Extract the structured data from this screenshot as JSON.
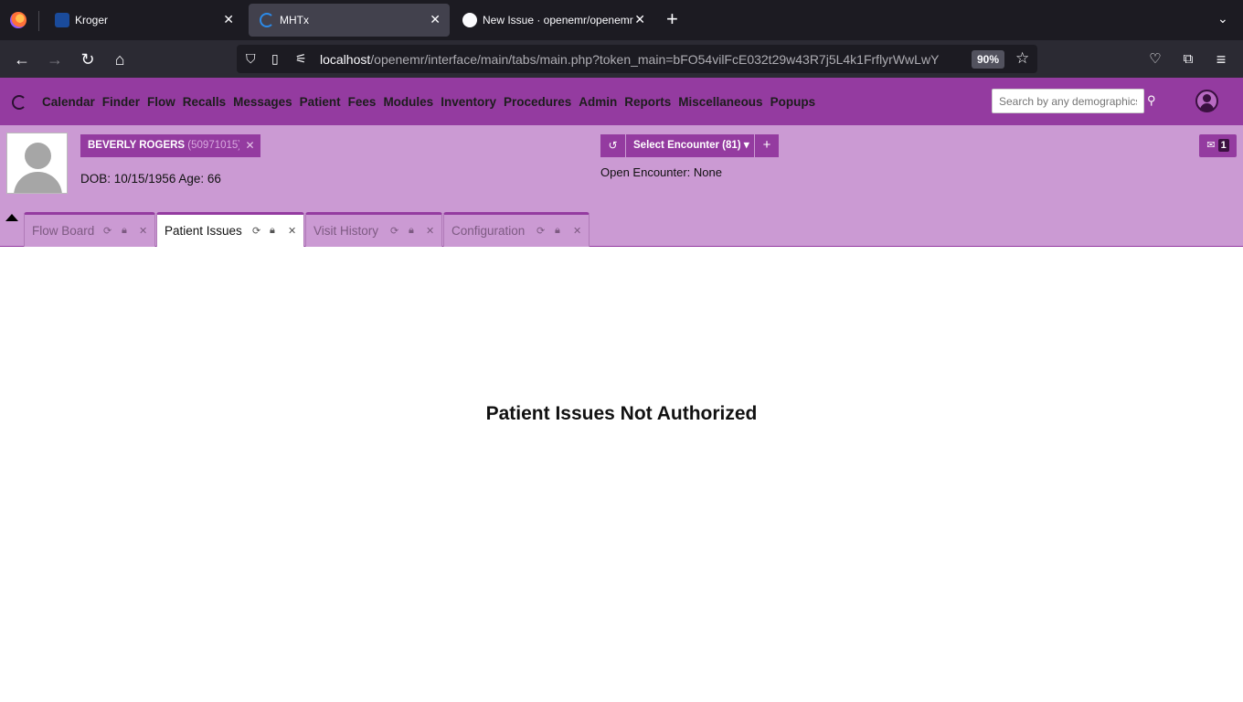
{
  "browser": {
    "tabs": [
      {
        "title": "Kroger",
        "active": false
      },
      {
        "title": "MHTx",
        "active": true
      },
      {
        "title": "New Issue · openemr/openemr",
        "active": false
      }
    ],
    "url_host": "localhost",
    "url_path": "/openemr/interface/main/tabs/main.php?token_main=bFO54vilFcE032t29w43R7j5L4k1FrflyrWwLwY",
    "zoom": "90%"
  },
  "menu": [
    "Calendar",
    "Finder",
    "Flow",
    "Recalls",
    "Messages",
    "Patient",
    "Fees",
    "Modules",
    "Inventory",
    "Procedures",
    "Admin",
    "Reports",
    "Miscellaneous",
    "Popups"
  ],
  "search": {
    "placeholder": "Search by any demographics"
  },
  "patient": {
    "name": "BEVERLY ROGERS",
    "pid": "(50971015)",
    "dob_label": "DOB: 10/15/1956 Age: 66"
  },
  "encounter": {
    "select_label": "Select Encounter",
    "count": "(81)",
    "open_label": "Open Encounter: None"
  },
  "messages": {
    "count": "1"
  },
  "tabs": [
    {
      "label": "Flow Board",
      "active": false
    },
    {
      "label": "Patient Issues",
      "active": true
    },
    {
      "label": "Visit History",
      "active": false
    },
    {
      "label": "Configuration",
      "active": false
    }
  ],
  "content": {
    "message": "Patient Issues Not Authorized"
  },
  "colors": {
    "primary": "#943ba0",
    "patient_bar": "#cb9ad3"
  }
}
